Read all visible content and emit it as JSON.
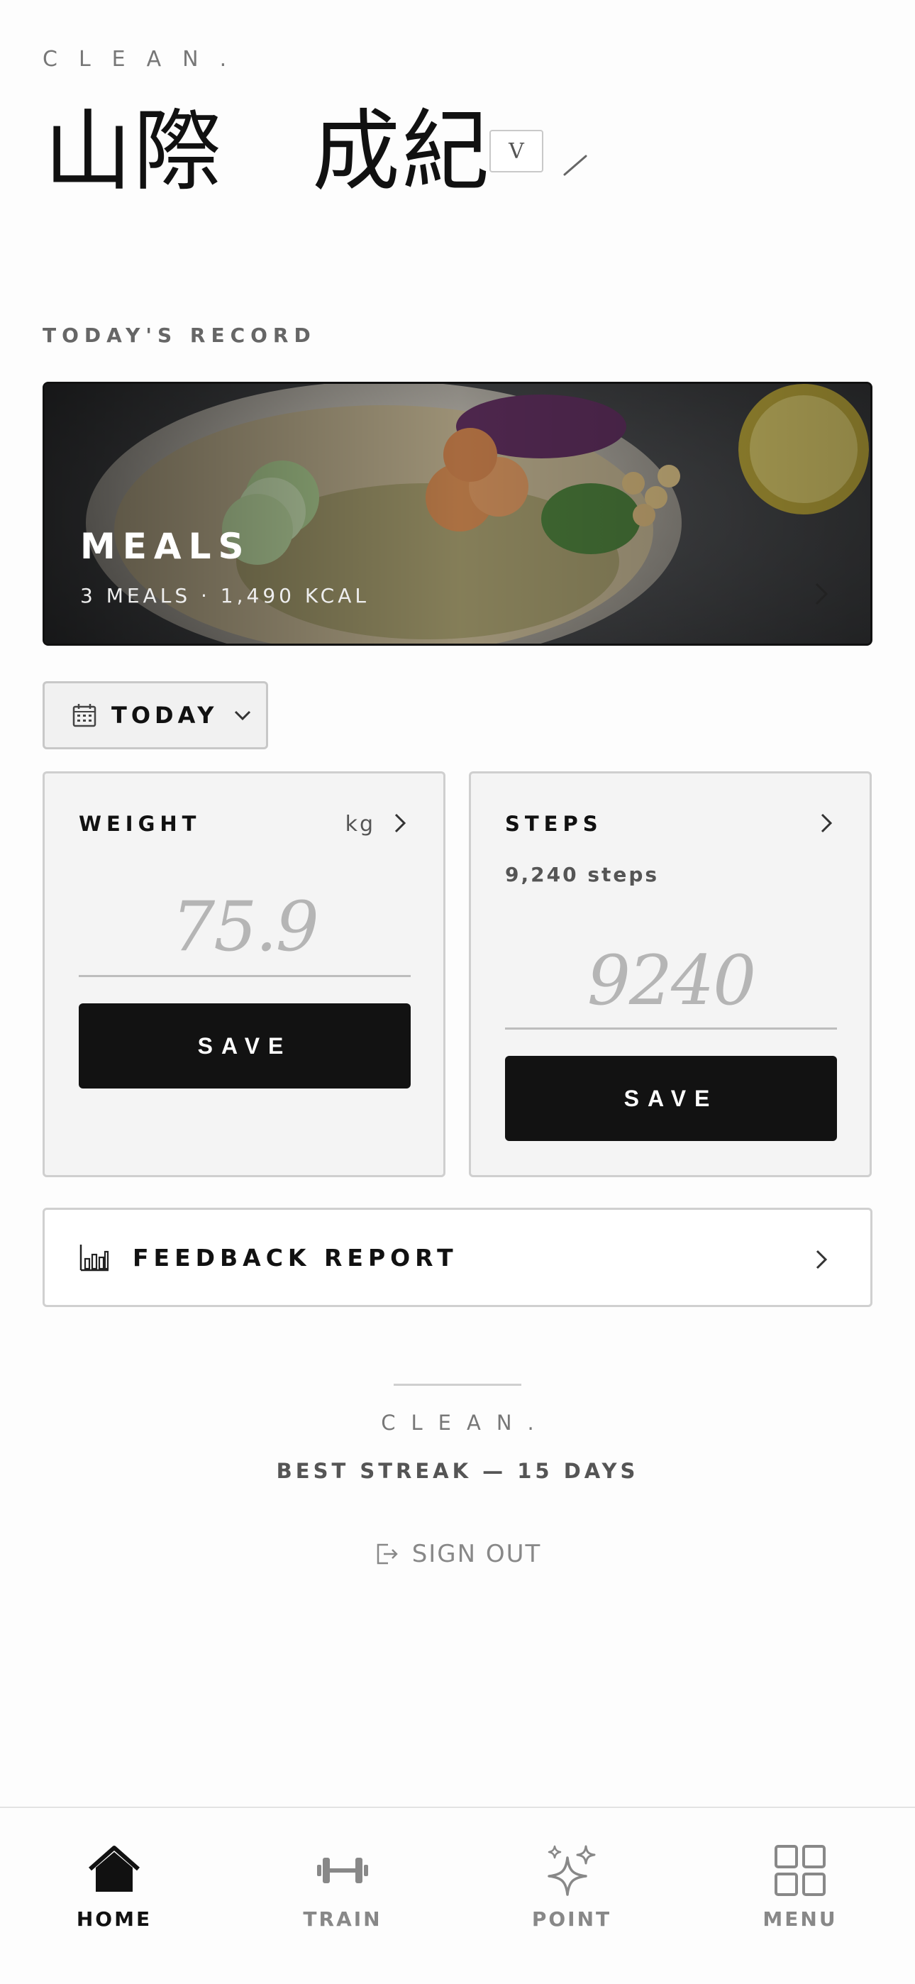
{
  "header": {
    "brand": "CLEAN.",
    "user_name": "山際　成紀",
    "badge": "V"
  },
  "record": {
    "section_label": "TODAY'S RECORD",
    "meals": {
      "title": "MEALS",
      "summary": "3 MEALS  ·  1,490 KCAL"
    },
    "date_selector": {
      "label": "TODAY"
    },
    "weight": {
      "title": "WEIGHT",
      "unit": "kg",
      "value": "75.9",
      "save_label": "SAVE"
    },
    "steps": {
      "title": "STEPS",
      "summary": "9,240 steps",
      "value": "9240",
      "save_label": "SAVE"
    },
    "feedback": {
      "label": "FEEDBACK REPORT"
    }
  },
  "footer": {
    "brand": "CLEAN.",
    "streak": "BEST STREAK — 15 DAYS",
    "sign_out": "SIGN OUT"
  },
  "tabs": [
    {
      "label": "HOME",
      "icon": "home-icon",
      "active": true
    },
    {
      "label": "TRAIN",
      "icon": "dumbbell-icon",
      "active": false
    },
    {
      "label": "POINT",
      "icon": "sparkles-icon",
      "active": false
    },
    {
      "label": "MENU",
      "icon": "grid-icon",
      "active": false
    }
  ],
  "colors": {
    "primary": "#121212",
    "card_bg": "#f4f4f4",
    "muted_text": "#777777",
    "placeholder_value": "#b5b5b5"
  }
}
